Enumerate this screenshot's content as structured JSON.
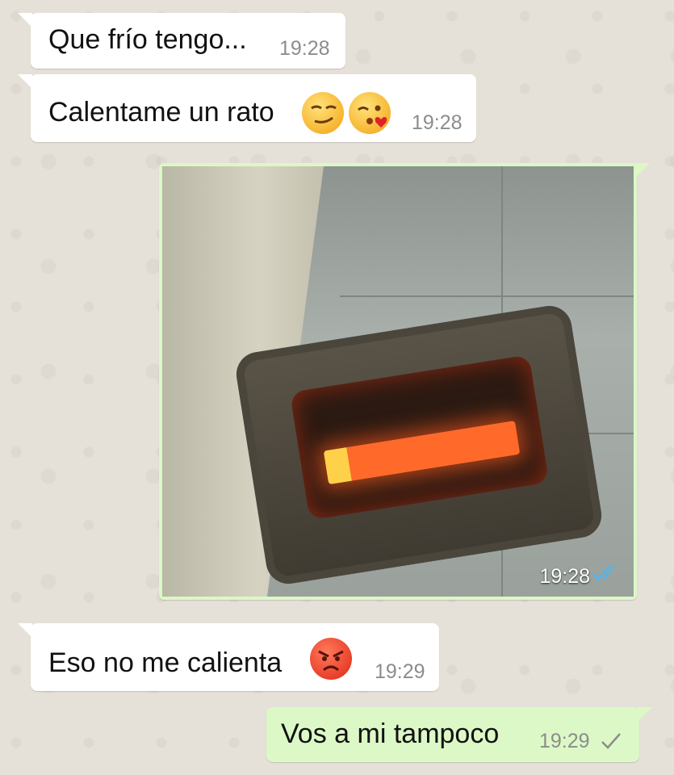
{
  "messages": [
    {
      "text": "Que frío tengo...",
      "time": "19:28"
    },
    {
      "text": "Calentame un rato",
      "time": "19:28",
      "emojis": [
        "smirking-face",
        "face-blowing-kiss"
      ]
    },
    {
      "photo_time": "19:28",
      "status_icon": "double-check-blue",
      "photo_description": ""
    },
    {
      "text": "Eso no me calienta",
      "time": "19:29",
      "emojis": [
        "angry-face"
      ]
    },
    {
      "text": "Vos a mi tampoco",
      "time": "19:29",
      "status_icon": "single-check-gray"
    }
  ],
  "colors": {
    "incoming_bubble": "#ffffff",
    "outgoing_bubble": "#dcf8c6",
    "read_tick": "#4fb6ec",
    "time_gray": "#8c8c8c"
  }
}
